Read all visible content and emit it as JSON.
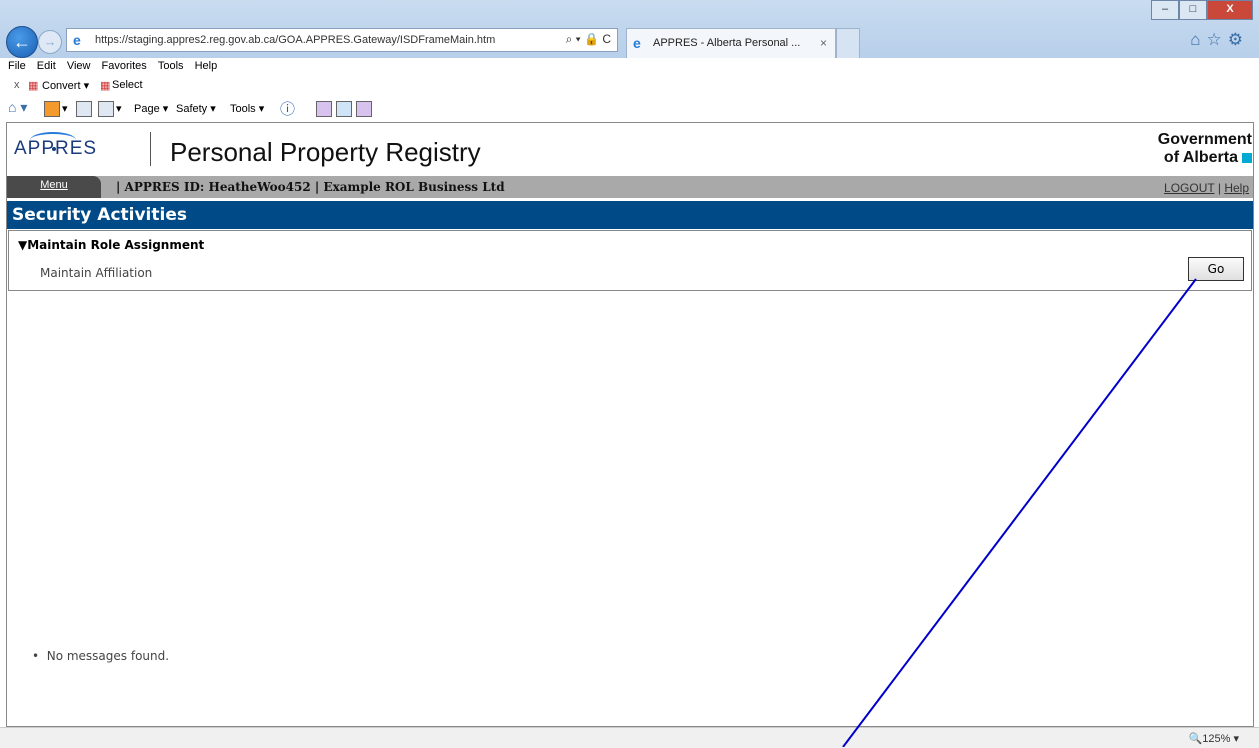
{
  "browser": {
    "url": "https://staging.appres2.reg.gov.ab.ca/GOA.APPRES.Gateway/ISDFrameMain.htm",
    "tab_title": "APPRES - Alberta Personal ...",
    "tab_close": "×",
    "addr_tools": "⌕ ▾ 🔒 C",
    "menu": [
      "File",
      "Edit",
      "View",
      "Favorites",
      "Tools",
      "Help"
    ],
    "cmd_close": "x",
    "convert_label": "Convert ▾",
    "select_label": "Select",
    "fav_page": "Page ▾",
    "fav_safety": "Safety ▾",
    "fav_tools": "Tools ▾",
    "zoom": "125%"
  },
  "app": {
    "logo": "APPRES",
    "title": "Personal Property Registry",
    "gov_line1": "Government",
    "gov_line2": "of Alberta",
    "menu_tab": "Menu",
    "id_text": "| APPRES ID: HeatheWoo452 |  Example ROL Business Ltd",
    "logout": "LOGOUT",
    "sep": "|",
    "help": "Help"
  },
  "section": {
    "title": "Security Activities",
    "group": "Maintain Role Assignment",
    "group_marker": "▼",
    "item": "Maintain Affiliation",
    "go": "Go"
  },
  "messages": {
    "bullet": "•",
    "text": "No messages found."
  },
  "colors": {
    "header_blue": "#004b87",
    "annotation_line": "#0000cc"
  }
}
